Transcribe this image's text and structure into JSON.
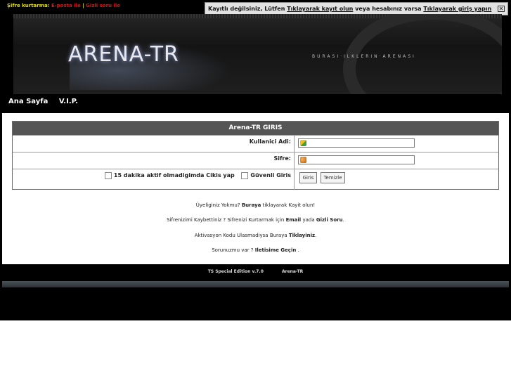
{
  "top": {
    "recover_label": "Şifre kurtarma:",
    "email_link": "E-posta ile",
    "separator": "|",
    "secret_link": "Gizli soru ile"
  },
  "notice": {
    "prefix": "Kayıtlı değilsiniz, Lütfen",
    "register_link": "Tıklayarak kayıt olun",
    "middle": "veya hesabınız varsa",
    "login_link": "Tıklayarak giriş yapın",
    "close_glyph": "✕"
  },
  "banner": {
    "logo": "ARENA-TR",
    "slogan": "BURASI·ILKLERIN·ARENASI"
  },
  "nav": {
    "items": [
      "Ana Sayfa",
      "V.I.P."
    ]
  },
  "login": {
    "title": "Arena-TR GIRIS",
    "username_label": "Kullanici Adi:",
    "password_label": "Sifre:",
    "auto_logout_label": "15 dakika aktif olmadigimda Cikis yap",
    "secure_label": "Güvenli Giris",
    "login_button": "Giris",
    "clear_button": "Temizle"
  },
  "info": {
    "line1_a": "Üyeliginiz Yokmu?",
    "line1_b": "Buraya",
    "line1_c": "tiklayarak Kayit olun!",
    "line2_a": "Sifrenizimi Kaybettiniz ? Sifrenizi Kurtarmak için",
    "line2_b": "Email",
    "line2_c": "yada",
    "line2_d": "Gizli Soru",
    "line3_a": "Aktivasyon Kodu Ulasmadiysa Buraya",
    "line3_b": "Tiklayiniz",
    "line4_a": "Sorunuzmu var ?",
    "line4_b": "Iletisime Geçin"
  },
  "footer": {
    "edition": "TS Special Edition v.7.0",
    "site": "Arena-TR"
  },
  "colors": {
    "top_yellow": "#e4e000",
    "top_red": "#e21010",
    "header_gray": "#555555"
  }
}
